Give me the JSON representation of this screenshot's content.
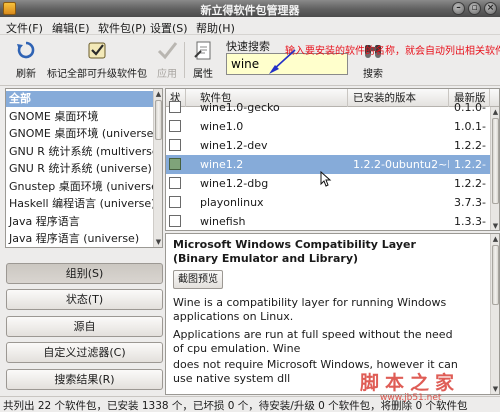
{
  "window": {
    "title": "新立得软件包管理器"
  },
  "menu": [
    "文件(F)",
    "编辑(E)",
    "软件包(P)",
    "设置(S)",
    "帮助(H)"
  ],
  "toolbar": {
    "refresh": "刷新",
    "mark_upgrades": "标记全部可升级软件包",
    "apply": "应用",
    "properties": "属性",
    "quick_search_label": "快速搜索",
    "quick_search_value": "wine",
    "search": "搜索"
  },
  "annotation": "输入要安装的软件的名称，就会自动列出相关软件",
  "categories": [
    {
      "label": "全部",
      "selected": true
    },
    {
      "label": "GNOME 桌面环境"
    },
    {
      "label": "GNOME 桌面环境 (universe)"
    },
    {
      "label": "GNU R 统计系统 (multiverse)"
    },
    {
      "label": "GNU R 统计系统 (universe)"
    },
    {
      "label": "Gnustep 桌面环境 (universe)"
    },
    {
      "label": "Haskell 编程语言 (universe)"
    },
    {
      "label": "Java 程序语言"
    },
    {
      "label": "Java 程序语言 (universe)"
    }
  ],
  "left_buttons": [
    {
      "label": "组别(S)",
      "pressed": true
    },
    {
      "label": "状态(T)"
    },
    {
      "label": "源自"
    },
    {
      "label": "自定义过滤器(C)"
    },
    {
      "label": "搜索结果(R)"
    }
  ],
  "table": {
    "headers": [
      "状",
      "软件包",
      "已安装的版本",
      "最新版"
    ],
    "rows": [
      {
        "name": "wine1.0-gecko",
        "installed": "",
        "latest": "0.1.0-"
      },
      {
        "name": "wine1.0",
        "installed": "",
        "latest": "1.0.1-"
      },
      {
        "name": "wine1.2-dev",
        "installed": "",
        "latest": "1.2.2-"
      },
      {
        "name": "wine1.2",
        "installed": "1.2.2-0ubuntu2~lu",
        "latest": "1.2.2-",
        "selected": true
      },
      {
        "name": "wine1.2-dbg",
        "installed": "",
        "latest": "1.2.2-"
      },
      {
        "name": "playonlinux",
        "installed": "",
        "latest": "3.7.3-"
      },
      {
        "name": "winefish",
        "installed": "",
        "latest": "1.3.3-"
      }
    ]
  },
  "description": {
    "title": "Microsoft Windows Compatibility Layer (Binary Emulator and Library)",
    "screenshot_button": "截图预览",
    "paragraphs": [
      "Wine is a compatibility layer for running Windows applications on Linux.",
      "Applications are run at full speed without the need of cpu emulation. Wine",
      "does not require Microsoft Windows, however it can use native system dll"
    ]
  },
  "status": "共列出 22 个软件包，已安装 1338 个，已坏损 0 个，待安装/升级 0 个软件包，将删除 0 个软件包",
  "watermark": {
    "big": "脚本之家",
    "small": "www.jb51.net"
  }
}
